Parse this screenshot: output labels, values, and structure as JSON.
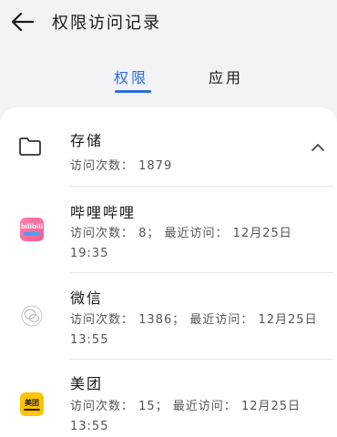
{
  "header": {
    "title": "权限访问记录"
  },
  "tabs": {
    "permissions": "权限",
    "apps": "应用"
  },
  "group": {
    "title": "存储",
    "summary": "访问次数： 1879"
  },
  "apps": [
    {
      "name": "哔哩哔哩",
      "detail": "访问次数： 8； 最近访问： 12月25日 19:35",
      "icon": "bilibili-icon",
      "icon_text": "bilibili"
    },
    {
      "name": "微信",
      "detail": "访问次数： 1386； 最近访问： 12月25日 13:55",
      "icon": "wechat-icon"
    },
    {
      "name": "美团",
      "detail": "访问次数： 15； 最近访问： 12月25日 13:55",
      "icon": "meituan-icon",
      "icon_text": "美团"
    }
  ],
  "colors": {
    "accent": "#2d6cdf",
    "background": "#f1f3f5",
    "card": "#ffffff"
  }
}
